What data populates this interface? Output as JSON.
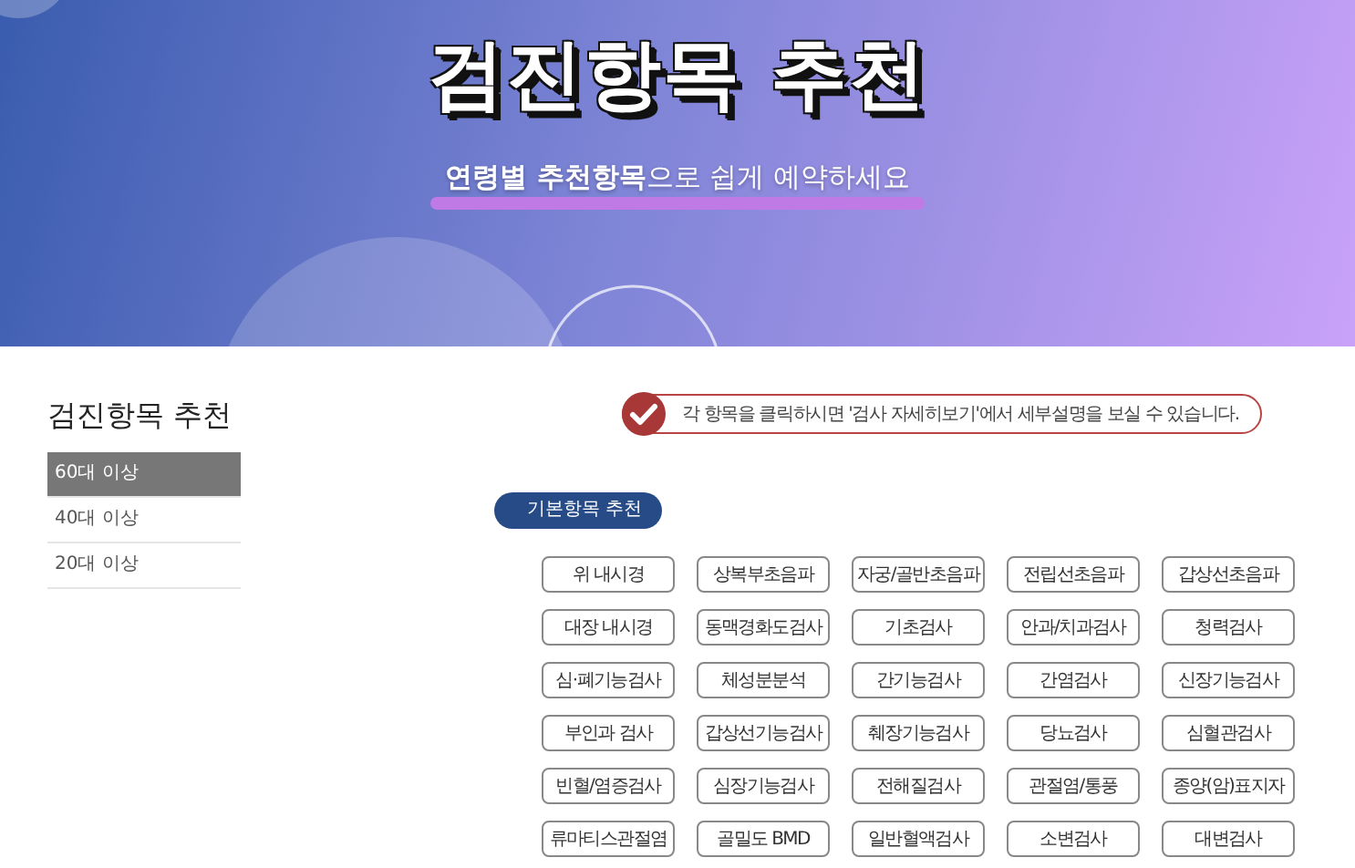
{
  "hero": {
    "title": "검진항목 추천",
    "subtitle": "**연령별 추천항목**으로 쉽게 예약하세요"
  },
  "sidebar": {
    "title": "검진항목 추천",
    "items": [
      {
        "label": "60대 이상",
        "selected": true
      },
      {
        "label": "40대 이상",
        "selected": false
      },
      {
        "label": "20대 이상",
        "selected": false
      }
    ]
  },
  "notice": "각 항목을 클릭하시면 '검사 자세히보기'에서 세부설명을 보실 수 있습니다.",
  "section_tag": "기본항목 추천",
  "items": [
    "위 내시경",
    "상복부초음파",
    "자궁/골반초음파",
    "전립선초음파",
    "갑상선초음파",
    "대장 내시경",
    "동맥경화도검사",
    "기초검사",
    "안과/치과검사",
    "청력검사",
    "심·폐기능검사",
    "체성분분석",
    "간기능검사",
    "간염검사",
    "신장기능검사",
    "부인과 검사",
    "갑상선기능검사",
    "췌장기능검사",
    "당뇨검사",
    "심혈관검사",
    "빈혈/염증검사",
    "심장기능검사",
    "전해질검사",
    "관절염/통풍",
    "종양(암)표지자",
    "류마티스관절염",
    "골밀도 BMD",
    "일반혈액검사",
    "소변검사",
    "대변검사"
  ]
}
